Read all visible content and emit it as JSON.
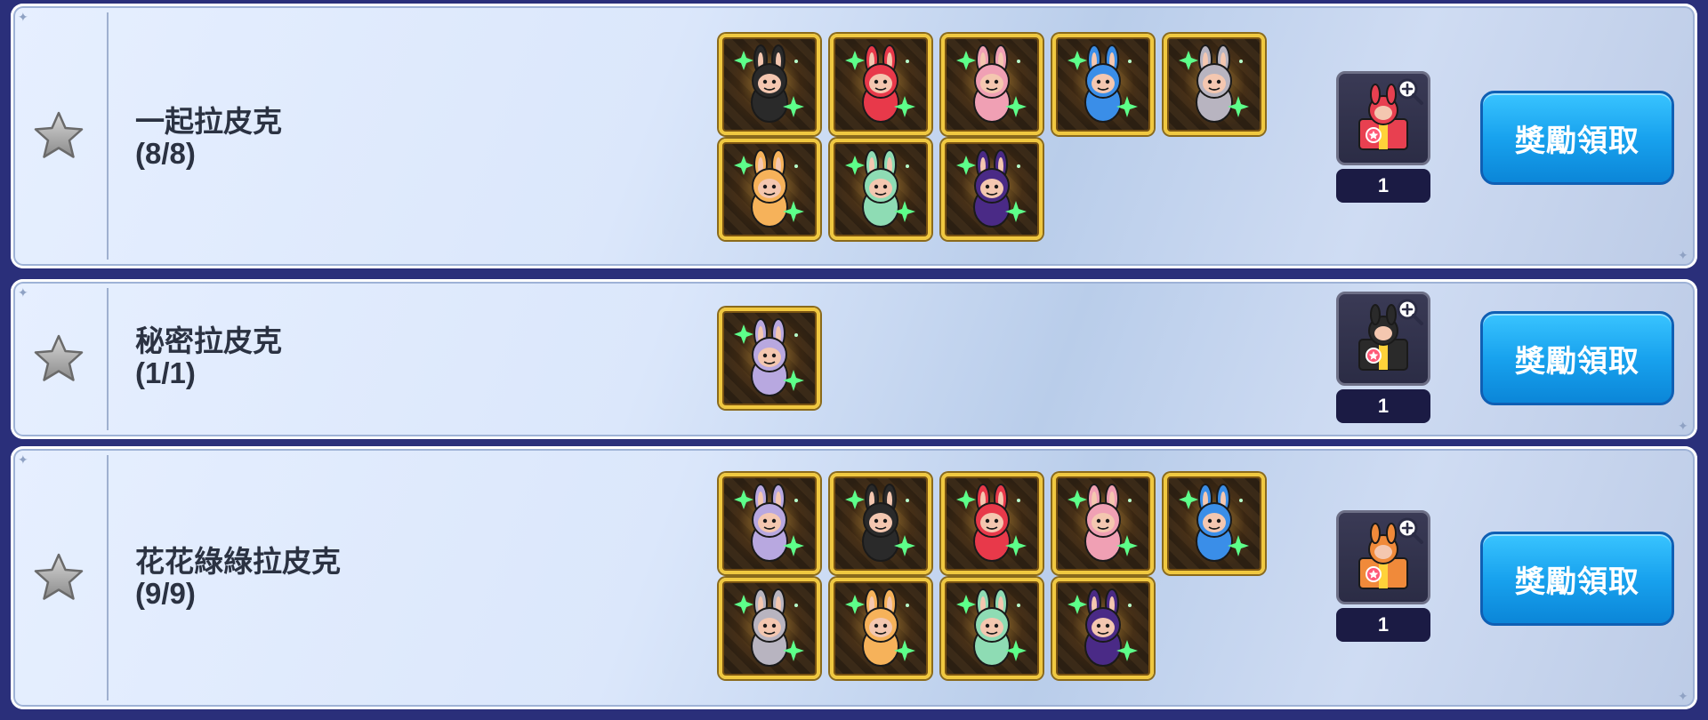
{
  "collections": [
    {
      "title": "一起拉皮克",
      "progress": "(8/8)",
      "items": [
        {
          "icon": "labubu-black-icon",
          "color": "#2a2a2a"
        },
        {
          "icon": "labubu-red-icon",
          "color": "#e8394a"
        },
        {
          "icon": "labubu-pink-icon",
          "color": "#f0a0b4"
        },
        {
          "icon": "labubu-blue-icon",
          "color": "#3a8ee8"
        },
        {
          "icon": "labubu-gray-icon",
          "color": "#b8b4c0"
        },
        {
          "icon": "labubu-orange-icon",
          "color": "#f6b25a"
        },
        {
          "icon": "labubu-mint-icon",
          "color": "#8edcb4"
        },
        {
          "icon": "labubu-purple-icon",
          "color": "#4a2a86"
        }
      ],
      "reward": {
        "icon": "red-gift-box-icon",
        "color": "#e84050",
        "count": "1"
      },
      "claim_label": "獎勵領取"
    },
    {
      "title": "秘密拉皮克",
      "progress": "(1/1)",
      "items": [
        {
          "icon": "labubu-lavender-icon",
          "color": "#b8a8e0"
        }
      ],
      "reward": {
        "icon": "black-gift-box-icon",
        "color": "#2a2a2a",
        "count": "1"
      },
      "claim_label": "獎勵領取"
    },
    {
      "title": "花花綠綠拉皮克",
      "progress": "(9/9)",
      "items": [
        {
          "icon": "labubu-lavender-icon",
          "color": "#b8a8e0"
        },
        {
          "icon": "labubu-black-icon",
          "color": "#2a2a2a"
        },
        {
          "icon": "labubu-red-icon",
          "color": "#e8394a"
        },
        {
          "icon": "labubu-pink-icon",
          "color": "#f0a0b4"
        },
        {
          "icon": "labubu-blue-icon",
          "color": "#3a8ee8"
        },
        {
          "icon": "labubu-gray-icon",
          "color": "#b8b4c0"
        },
        {
          "icon": "labubu-orange-icon",
          "color": "#f6b25a"
        },
        {
          "icon": "labubu-mint-icon",
          "color": "#8edcb4"
        },
        {
          "icon": "labubu-purple-icon",
          "color": "#4a2a86"
        }
      ],
      "reward": {
        "icon": "orange-gift-box-icon",
        "color": "#f08a3a",
        "count": "1"
      },
      "claim_label": "獎勵領取"
    }
  ]
}
